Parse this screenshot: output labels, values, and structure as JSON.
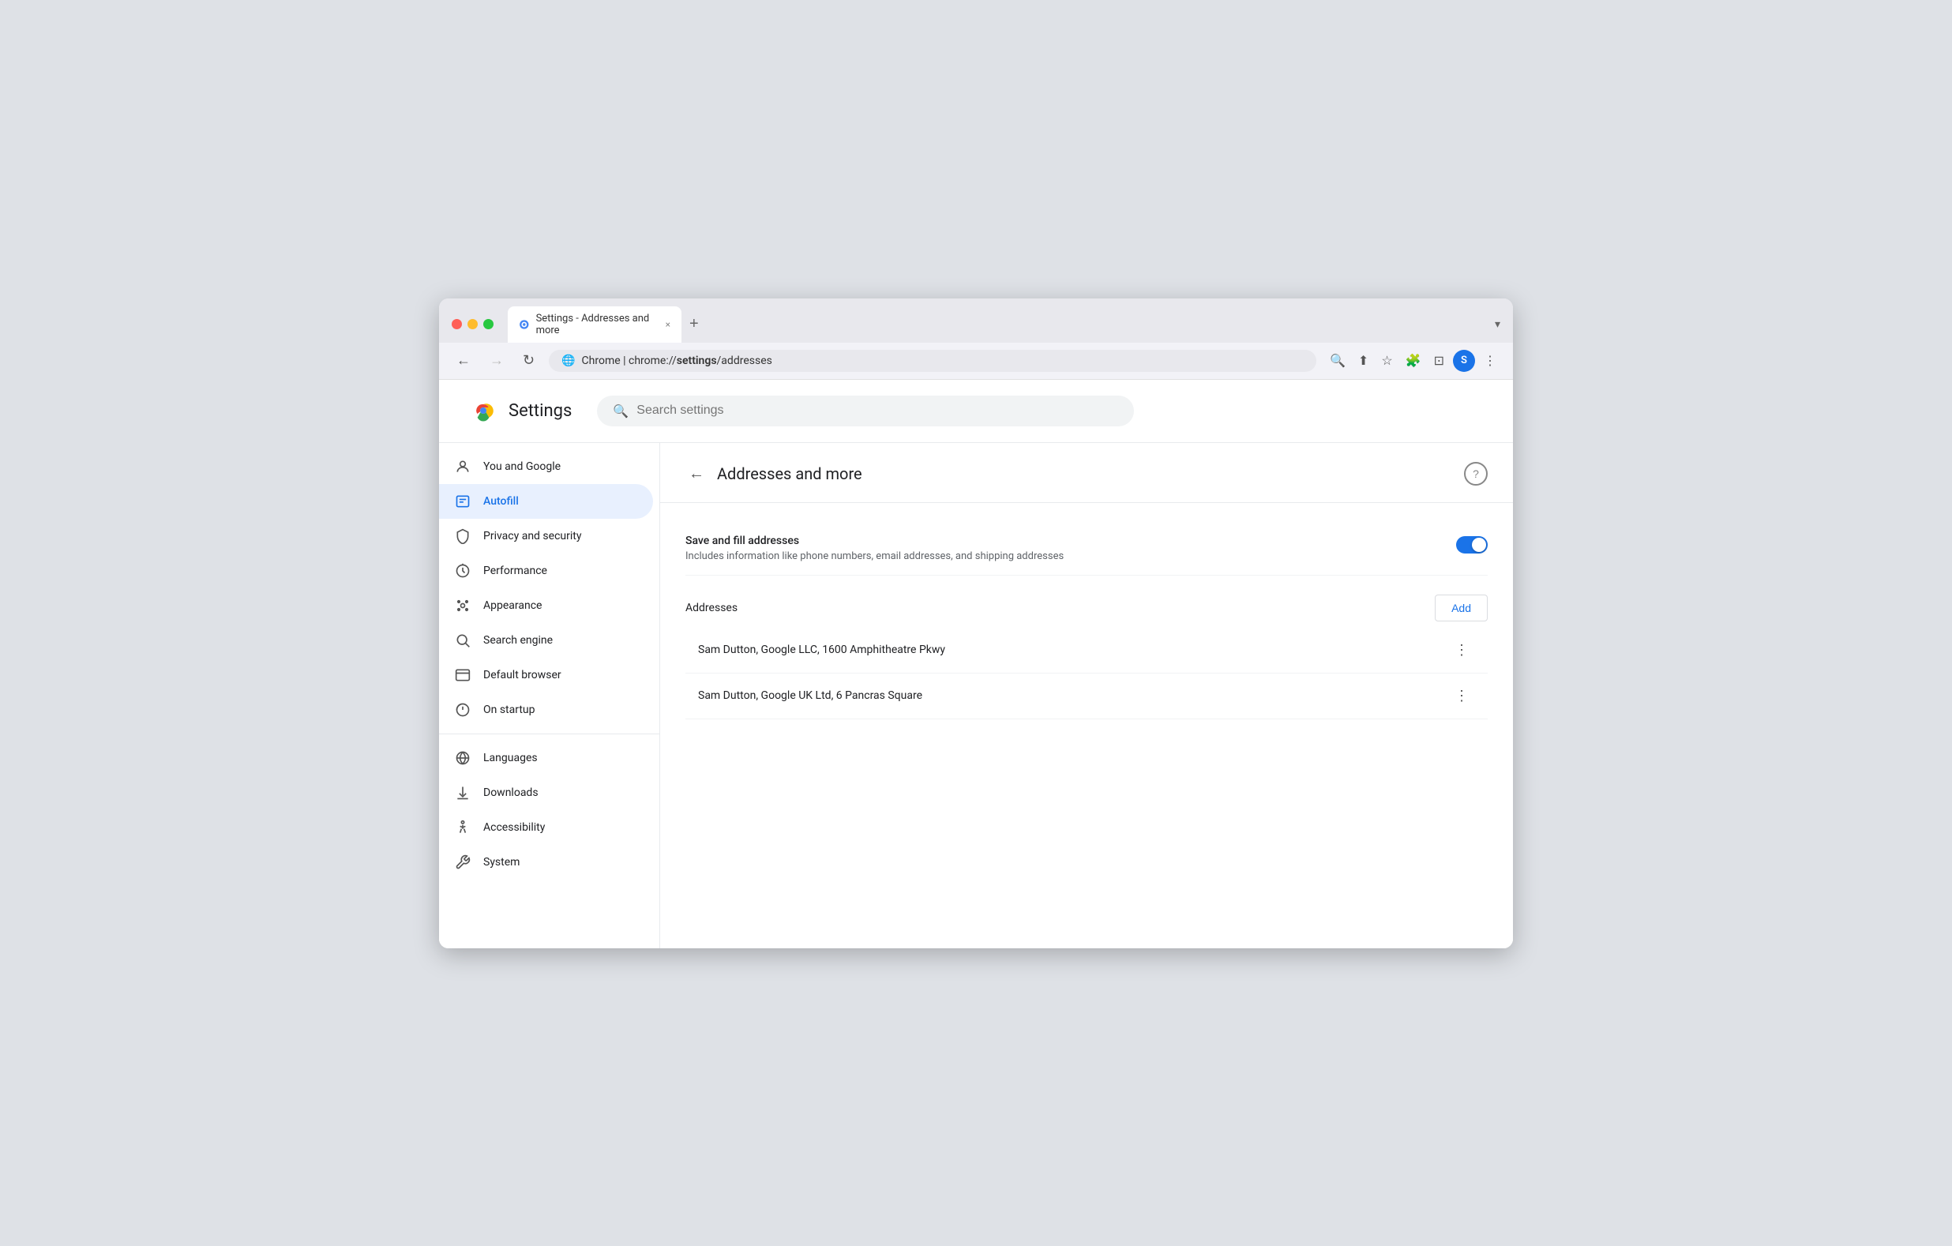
{
  "browser": {
    "tab_title": "Settings - Addresses and more",
    "tab_close": "×",
    "tab_new": "+",
    "tab_dropdown": "▾",
    "nav": {
      "back": "←",
      "forward": "→",
      "refresh": "↻",
      "url_prefix": "Chrome  |  chrome://",
      "url_path": "settings",
      "url_suffix": "/addresses",
      "url_display": "chrome://settings/addresses",
      "search_icon": "🔍",
      "share_icon": "⬆",
      "bookmark_icon": "☆",
      "extensions_icon": "🧩",
      "split_icon": "⊡",
      "menu_icon": "⋮"
    },
    "avatar_initial": "S"
  },
  "settings": {
    "logo_alt": "Google Chrome",
    "title": "Settings",
    "search_placeholder": "Search settings"
  },
  "sidebar": {
    "items": [
      {
        "id": "you-and-google",
        "label": "You and Google",
        "icon": "👤"
      },
      {
        "id": "autofill",
        "label": "Autofill",
        "icon": "📋",
        "active": true
      },
      {
        "id": "privacy-security",
        "label": "Privacy and security",
        "icon": "🛡"
      },
      {
        "id": "performance",
        "label": "Performance",
        "icon": "⏱"
      },
      {
        "id": "appearance",
        "label": "Appearance",
        "icon": "🎨"
      },
      {
        "id": "search-engine",
        "label": "Search engine",
        "icon": "🔍"
      },
      {
        "id": "default-browser",
        "label": "Default browser",
        "icon": "🖥"
      },
      {
        "id": "on-startup",
        "label": "On startup",
        "icon": "⏻"
      }
    ],
    "items2": [
      {
        "id": "languages",
        "label": "Languages",
        "icon": "🌐"
      },
      {
        "id": "downloads",
        "label": "Downloads",
        "icon": "⬇"
      },
      {
        "id": "accessibility",
        "label": "Accessibility",
        "icon": "♿"
      },
      {
        "id": "system",
        "label": "System",
        "icon": "🔧"
      }
    ]
  },
  "panel": {
    "back_button": "←",
    "title": "Addresses and more",
    "help_label": "?",
    "save_fill": {
      "label": "Save and fill addresses",
      "description": "Includes information like phone numbers, email addresses, and shipping addresses",
      "enabled": true
    },
    "addresses_section": {
      "label": "Addresses",
      "add_button": "Add",
      "items": [
        {
          "text": "Sam Dutton, Google LLC, 1600 Amphitheatre Pkwy"
        },
        {
          "text": "Sam Dutton, Google UK Ltd, 6 Pancras Square"
        }
      ],
      "more_icon": "⋮"
    }
  }
}
